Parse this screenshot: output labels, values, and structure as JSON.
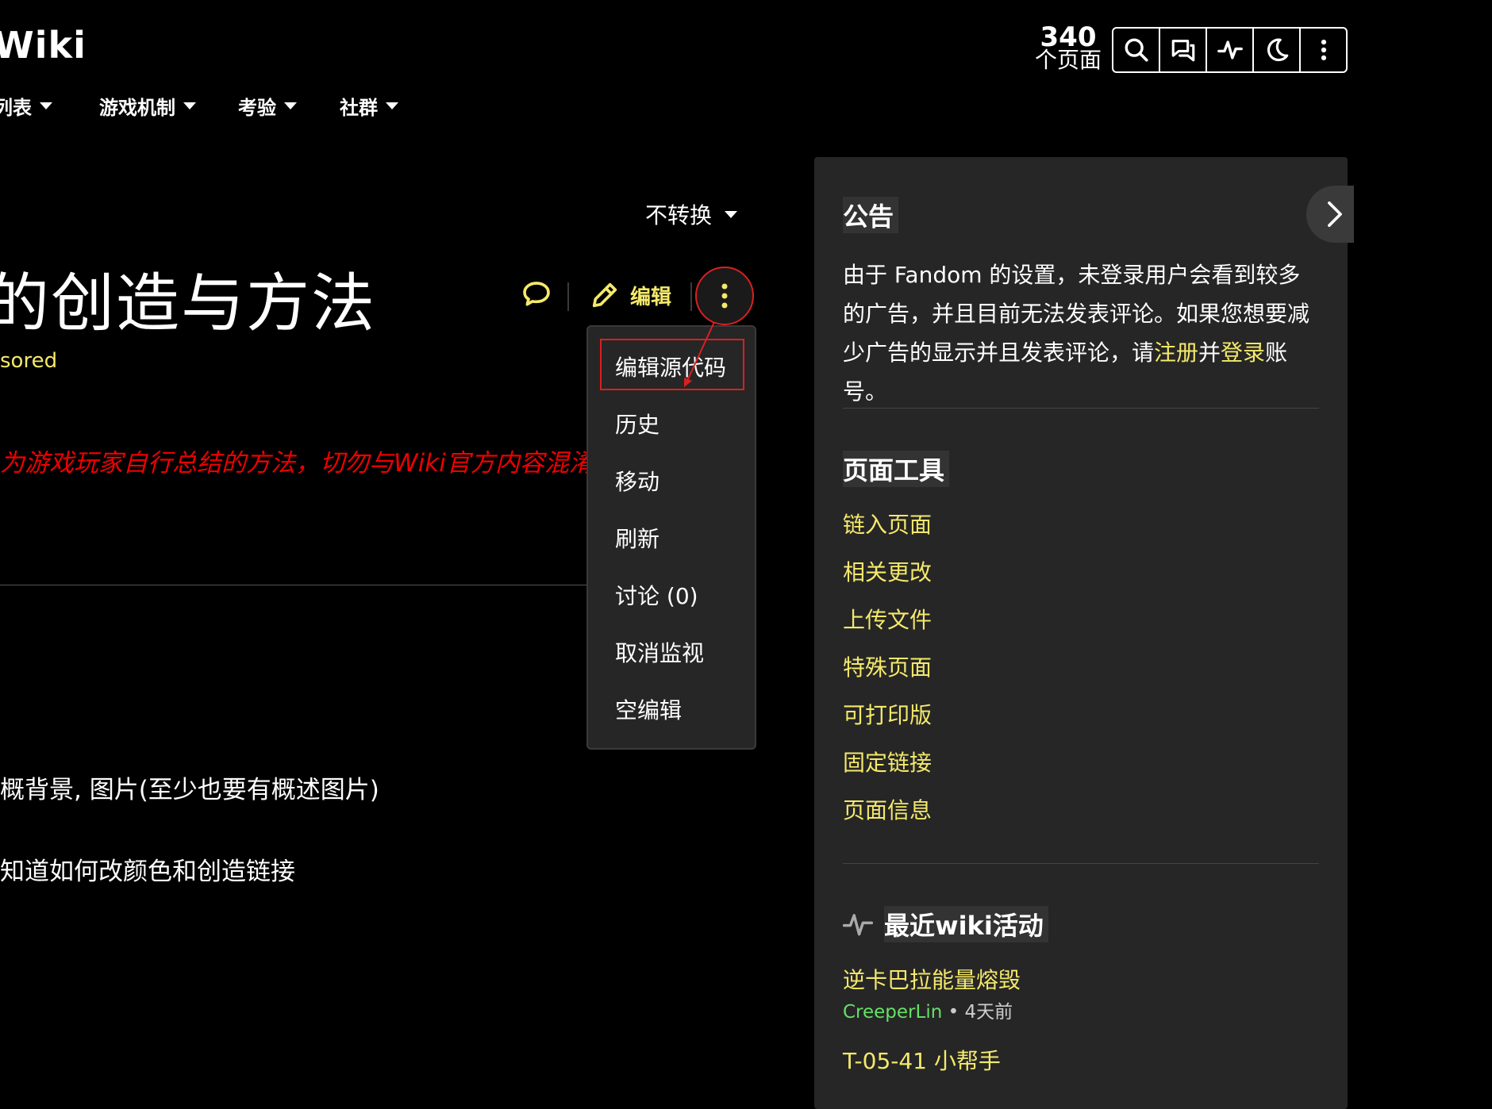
{
  "header": {
    "logo": "Wiki",
    "page_count": "340",
    "page_count_label": "个页面",
    "nav": [
      {
        "label": "列表"
      },
      {
        "label": "游戏机制"
      },
      {
        "label": "考验"
      },
      {
        "label": "社群"
      }
    ],
    "toolbar_icons": [
      "search-icon",
      "discussions-icon",
      "activity-icon",
      "dark-mode-icon",
      "more-vertical-icon"
    ]
  },
  "article": {
    "variant_label": "不转换",
    "title": "的创造与方法",
    "sponsored": "sored",
    "notice": "为游戏玩家自行总结的方法，切勿与Wiki官方内容混淆",
    "edit_label": "编辑",
    "body_lines": [
      "概背景, 图片(至少也要有概述图片)",
      "知道如何改颜色和创造链接"
    ]
  },
  "dropdown": {
    "items": [
      "编辑源代码",
      "历史",
      "移动",
      "刷新",
      "讨论 (0)",
      "取消监视",
      "空编辑"
    ]
  },
  "rail": {
    "announcement_heading": "公告",
    "announcement_text_1": "由于 Fandom 的设置，未登录用户会看到较多的广告，并且目前无法发表评论。如果您想要减少广告的显示并且发表评论，请",
    "register_link": "注册",
    "and_text": "并",
    "login_link": "登录",
    "account_text": "账号。",
    "tools_heading": "页面工具",
    "tools": [
      "链入页面",
      "相关更改",
      "上传文件",
      "特殊页面",
      "可打印版",
      "固定链接",
      "页面信息"
    ],
    "activity_heading": "最近wiki活动",
    "activity": [
      {
        "title": "逆卡巴拉能量熔毁",
        "user": "CreeperLin",
        "time": "4天前"
      },
      {
        "title": "T-05-41 小帮手"
      }
    ]
  },
  "colors": {
    "background": "#000000",
    "rail_background": "#262626",
    "link": "#f4e96b",
    "notice": "#e00000",
    "highlight": "#d92020",
    "user": "#66e066"
  }
}
